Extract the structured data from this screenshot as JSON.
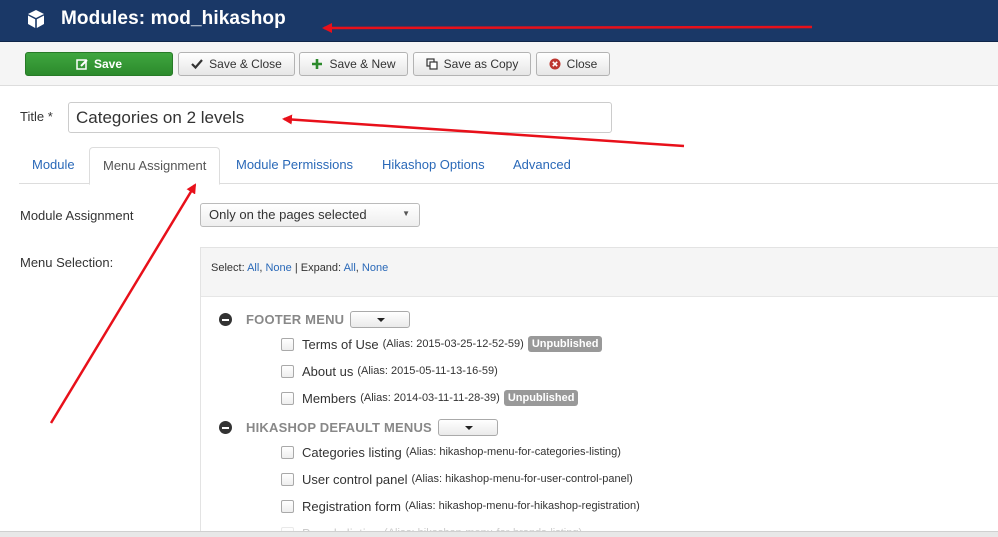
{
  "header": {
    "title": "Modules: mod_hikashop",
    "icon": "cube-icon"
  },
  "toolbar": {
    "save": "Save",
    "save_close": "Save & Close",
    "save_new": "Save & New",
    "save_copy": "Save as Copy",
    "close": "Close"
  },
  "form": {
    "title_label": "Title *",
    "title_value": "Categories on 2 levels"
  },
  "tabs": [
    "Module",
    "Menu Assignment",
    "Module Permissions",
    "Hikashop Options",
    "Advanced"
  ],
  "active_tab": "Menu Assignment",
  "assignment": {
    "label": "Module Assignment",
    "selected": "Only on the pages selected"
  },
  "menu_selection": {
    "label": "Menu Selection:",
    "select_text": "Select:",
    "all": "All",
    "none": "None",
    "expand_text": "Expand:",
    "expand_all": "All",
    "expand_none": "None",
    "groups": [
      {
        "name": "FOOTER MENU",
        "items": [
          {
            "name": "Terms of Use",
            "alias": "(Alias: 2015-03-25-12-52-59)",
            "badge": "Unpublished"
          },
          {
            "name": "About us",
            "alias": "(Alias: 2015-05-11-13-16-59)",
            "badge": ""
          },
          {
            "name": "Members",
            "alias": "(Alias: 2014-03-11-11-28-39)",
            "badge": "Unpublished"
          }
        ]
      },
      {
        "name": "HIKASHOP DEFAULT MENUS",
        "items": [
          {
            "name": "Categories listing",
            "alias": "(Alias: hikashop-menu-for-categories-listing)",
            "badge": ""
          },
          {
            "name": "User control panel",
            "alias": "(Alias: hikashop-menu-for-user-control-panel)",
            "badge": ""
          },
          {
            "name": "Registration form",
            "alias": "(Alias: hikashop-menu-for-hikashop-registration)",
            "badge": ""
          },
          {
            "name": "Brands listing",
            "alias": "(Alias: hikashop-menu-for-brands-listing)",
            "badge": ""
          }
        ]
      }
    ]
  },
  "colors": {
    "header_bg": "#1a3867",
    "save_green": "#2f932f",
    "link_blue": "#2a69b8",
    "annotation_red": "#e8101a",
    "badge_grey": "#999999"
  }
}
